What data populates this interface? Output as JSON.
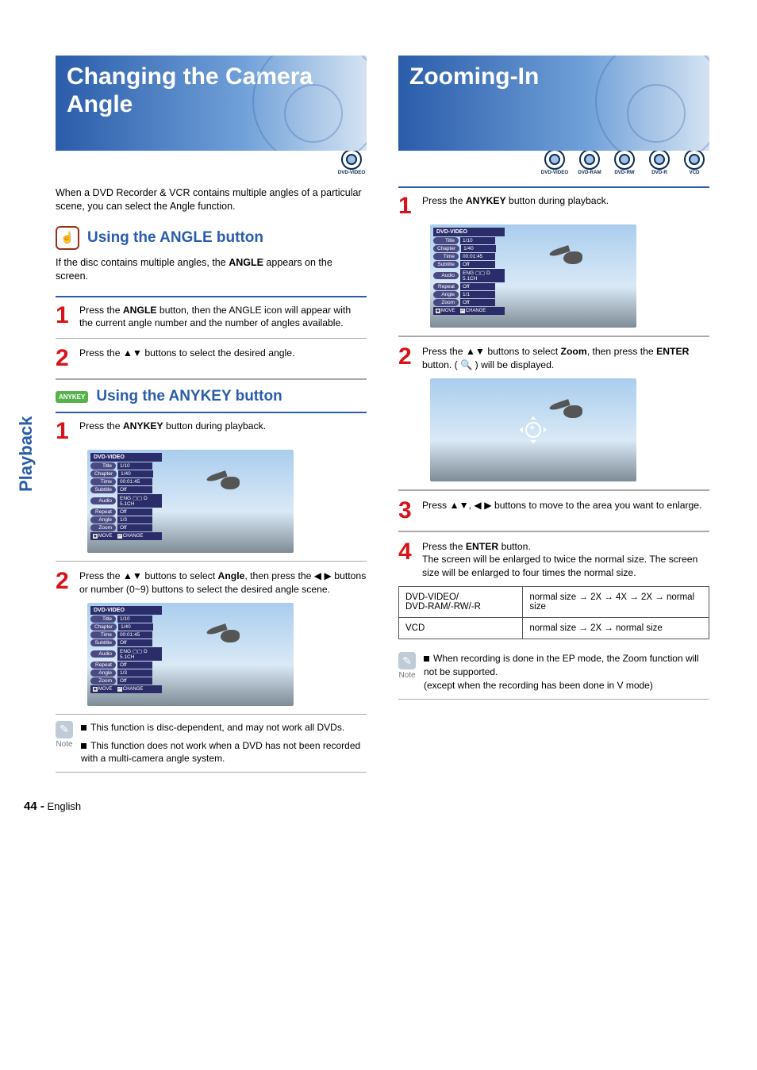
{
  "sidebar_label": "Playback",
  "left": {
    "title": "Changing the Camera Angle",
    "disc_badges": [
      "DVD-VIDEO"
    ],
    "intro": "When a DVD Recorder & VCR contains multiple angles of a particular scene, you can select the Angle function.",
    "h2a": "Using the ANGLE button",
    "h2a_sub": "If the disc contains multiple angles, the ANGLE appears on the screen.",
    "step1a": "Press the ANGLE button, then the ANGLE icon will appear with the current angle number and the number of angles available.",
    "step2a": "Press the ▲▼ buttons  to select the desired angle.",
    "anykey_label": "ANYKEY",
    "h2b": "Using the ANYKEY button",
    "step1b": "Press the ANYKEY button during playback.",
    "step2b_pre": "Press the ▲▼ buttons to select ",
    "step2b_bold": "Angle",
    "step2b_post": ", then press the ◀ ▶ buttons or number (0~9) buttons to select the desired angle scene.",
    "note1": "This function is disc-dependent, and may not work all DVDs.",
    "note2": "This function does not work when a DVD has not been recorded with a multi-camera angle system.",
    "note_label": "Note",
    "osd": {
      "header": "DVD-VIDEO",
      "rows": [
        {
          "label": "Title",
          "value": "1/10"
        },
        {
          "label": "Chapter",
          "value": "1/40"
        },
        {
          "label": "Time",
          "value": "00:01:45"
        },
        {
          "label": "Subtitle",
          "value": "Off"
        },
        {
          "label": "Audio",
          "value": "ENG ▢▢ D  5.1CH"
        },
        {
          "label": "Repeat",
          "value": "Off"
        },
        {
          "label": "Angle",
          "value": "1/3"
        },
        {
          "label": "Zoom",
          "value": "Off"
        }
      ],
      "footer_move": "MOVE",
      "footer_change": "CHANGE"
    }
  },
  "right": {
    "title": "Zooming-In",
    "disc_badges": [
      "DVD-VIDEO",
      "DVD-RAM",
      "DVD-RW",
      "DVD-R",
      "VCD"
    ],
    "step1": "Press the ANYKEY button during playback.",
    "step2_pre": "Press the ▲▼ buttons to select ",
    "step2_bold": "Zoom",
    "step2_post": ", then press the ENTER button. (    ) will be displayed.",
    "step3": "Press ▲▼, ◀ ▶ buttons to move to the area you want to enlarge.",
    "step4": "Press the ENTER button.\nThe screen will be enlarged to twice the normal size. The screen size will be enlarged to four times the normal size.",
    "table": {
      "r1c1": "DVD-VIDEO/\nDVD-RAM/-RW/-R",
      "r1c2": "normal size → 2X → 4X → 2X → normal size",
      "r2c1": "VCD",
      "r2c2": "normal size → 2X → normal size"
    },
    "note": "When recording is done in the EP mode, the Zoom function will not be supported.\n(except when the recording has been done in V mode)",
    "note_label": "Note",
    "osd": {
      "header": "DVD-VIDEO",
      "rows": [
        {
          "label": "Title",
          "value": "1/10"
        },
        {
          "label": "Chapter",
          "value": "1/40"
        },
        {
          "label": "Time",
          "value": "00:01:45"
        },
        {
          "label": "Subtitle",
          "value": "Off"
        },
        {
          "label": "Audio",
          "value": "ENG ▢▢ D  5.1CH"
        },
        {
          "label": "Repeat",
          "value": "Off"
        },
        {
          "label": "Angle",
          "value": "1/1"
        },
        {
          "label": "Zoom",
          "value": "Off"
        }
      ],
      "footer_move": "MOVE",
      "footer_change": "CHANGE"
    }
  },
  "footer": {
    "page": "44 -",
    "lang": "English"
  }
}
